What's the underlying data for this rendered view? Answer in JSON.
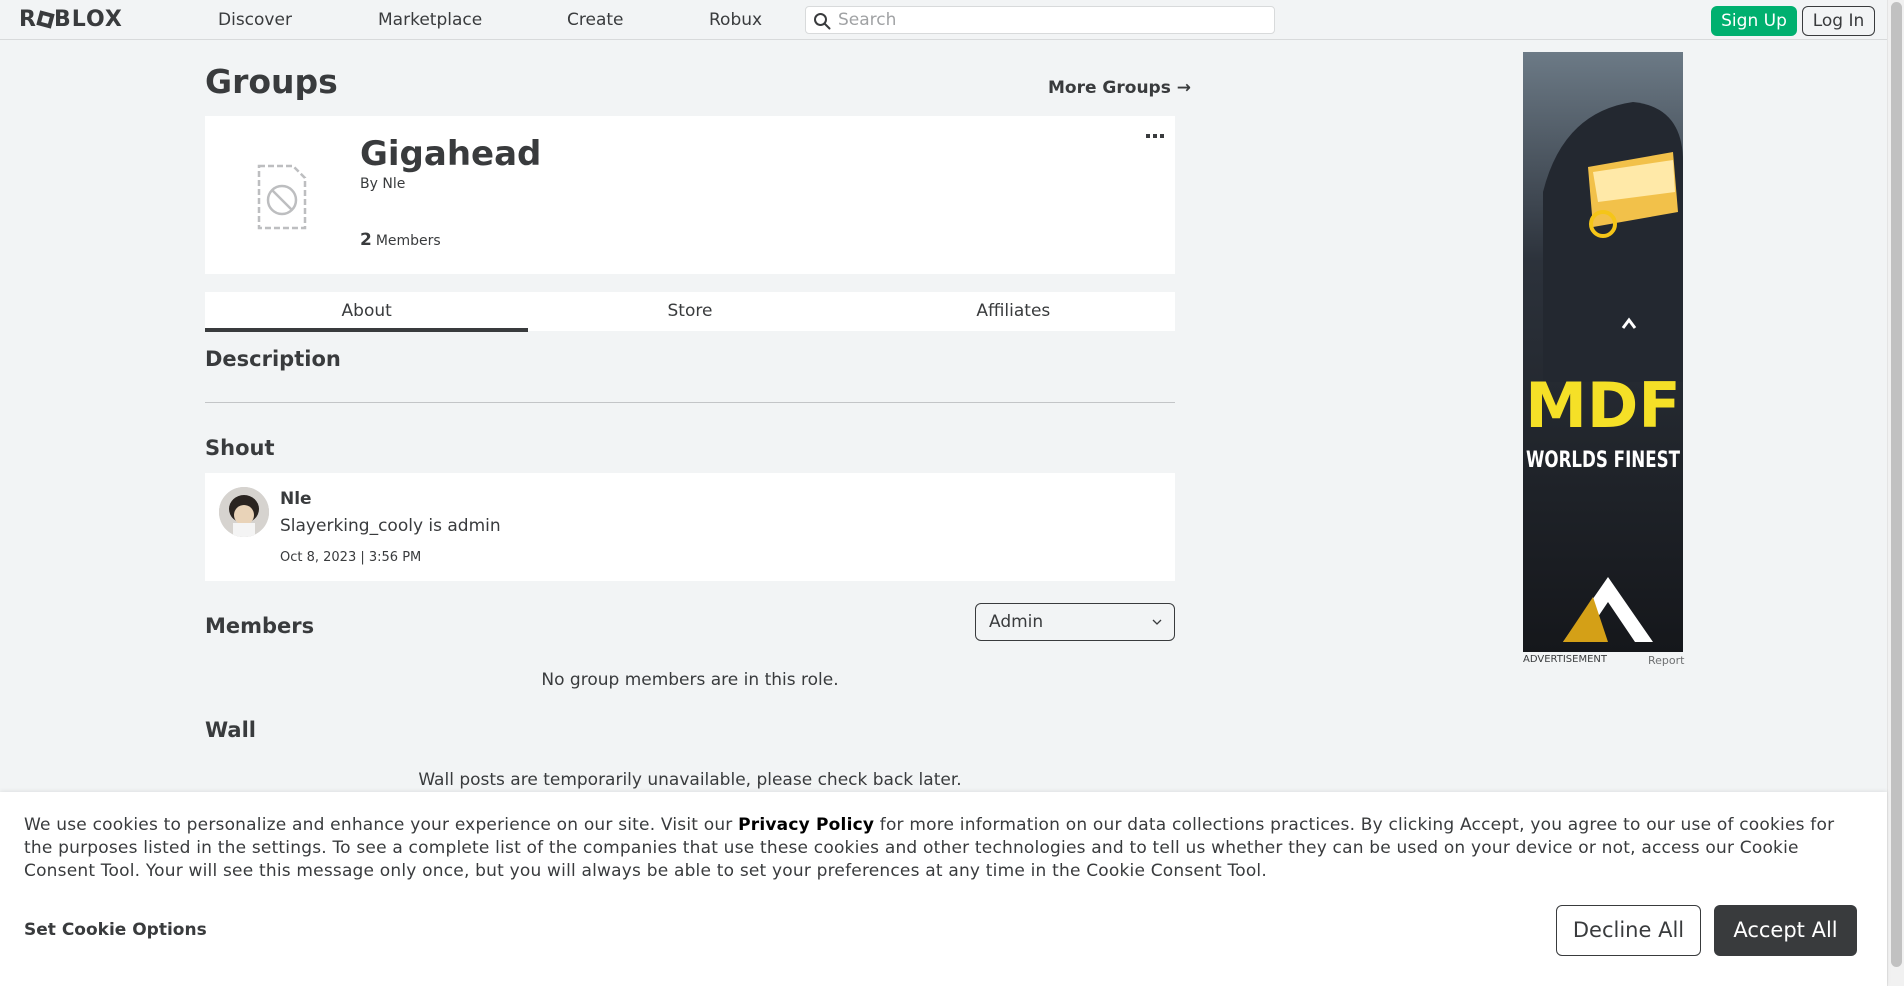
{
  "header": {
    "logo": "ROBLOX",
    "nav": [
      "Discover",
      "Marketplace",
      "Create",
      "Robux"
    ],
    "search_placeholder": "Search",
    "signup_label": "Sign Up",
    "login_label": "Log In"
  },
  "page": {
    "title": "Groups",
    "more_groups_label": "More Groups →"
  },
  "group": {
    "name": "Gigahead",
    "by_prefix": "By",
    "owner": "Nle",
    "member_count": "2",
    "members_label": "Members"
  },
  "tabs": [
    "About",
    "Store",
    "Affiliates"
  ],
  "about": {
    "description_heading": "Description",
    "shout_heading": "Shout",
    "shout": {
      "poster": "Nle",
      "body": "Slayerking_cooly is admin",
      "date": "Oct 8, 2023 | 3:56 PM"
    },
    "members_heading": "Members",
    "role_selected": "Admin",
    "no_members_msg": "No group members are in this role.",
    "wall_heading": "Wall",
    "wall_msg": "Wall posts are temporarily unavailable, please check back later."
  },
  "ad": {
    "label": "ADVERTISEMENT",
    "report": "Report",
    "brand": "MDF",
    "tagline": "WORLDS FINEST"
  },
  "cookie": {
    "text_before": "We use cookies to personalize and enhance your experience on our site. Visit our ",
    "privacy_link": "Privacy Policy",
    "text_after": " for more information on our data collections practices. By clicking Accept, you agree to our use of cookies for the purposes listed in the settings. To see a complete list of the companies that use these cookies and other technologies and to tell us whether they can be used on your device or not, access our Cookie Consent Tool. Your will see this message only once, but you will always be able to set your preferences at any time in the Cookie Consent Tool.",
    "set_options": "Set Cookie Options",
    "decline": "Decline All",
    "accept": "Accept All"
  },
  "colors": {
    "primary_text": "#393b3d",
    "signup_green": "#00b06f",
    "page_bg": "#f2f4f5"
  }
}
